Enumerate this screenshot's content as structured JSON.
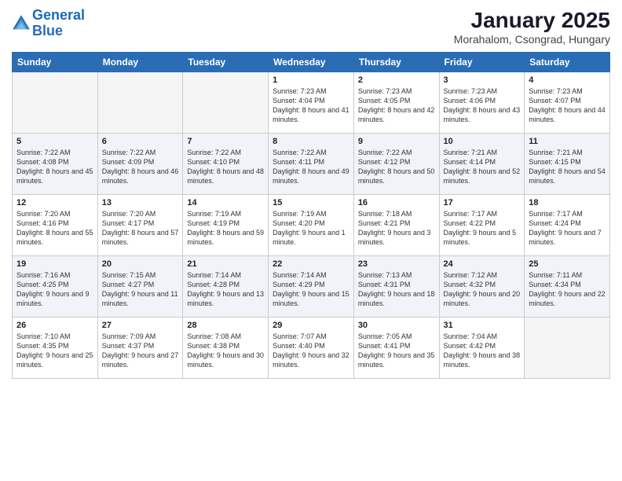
{
  "header": {
    "logo_line1": "General",
    "logo_line2": "Blue",
    "month_title": "January 2025",
    "location": "Morahalom, Csongrad, Hungary"
  },
  "days_of_week": [
    "Sunday",
    "Monday",
    "Tuesday",
    "Wednesday",
    "Thursday",
    "Friday",
    "Saturday"
  ],
  "weeks": [
    [
      {
        "day": "",
        "empty": true
      },
      {
        "day": "",
        "empty": true
      },
      {
        "day": "",
        "empty": true
      },
      {
        "day": "1",
        "sunrise": "7:23 AM",
        "sunset": "4:04 PM",
        "daylight": "8 hours and 41 minutes."
      },
      {
        "day": "2",
        "sunrise": "7:23 AM",
        "sunset": "4:05 PM",
        "daylight": "8 hours and 42 minutes."
      },
      {
        "day": "3",
        "sunrise": "7:23 AM",
        "sunset": "4:06 PM",
        "daylight": "8 hours and 43 minutes."
      },
      {
        "day": "4",
        "sunrise": "7:23 AM",
        "sunset": "4:07 PM",
        "daylight": "8 hours and 44 minutes."
      }
    ],
    [
      {
        "day": "5",
        "sunrise": "7:22 AM",
        "sunset": "4:08 PM",
        "daylight": "8 hours and 45 minutes."
      },
      {
        "day": "6",
        "sunrise": "7:22 AM",
        "sunset": "4:09 PM",
        "daylight": "8 hours and 46 minutes."
      },
      {
        "day": "7",
        "sunrise": "7:22 AM",
        "sunset": "4:10 PM",
        "daylight": "8 hours and 48 minutes."
      },
      {
        "day": "8",
        "sunrise": "7:22 AM",
        "sunset": "4:11 PM",
        "daylight": "8 hours and 49 minutes."
      },
      {
        "day": "9",
        "sunrise": "7:22 AM",
        "sunset": "4:12 PM",
        "daylight": "8 hours and 50 minutes."
      },
      {
        "day": "10",
        "sunrise": "7:21 AM",
        "sunset": "4:14 PM",
        "daylight": "8 hours and 52 minutes."
      },
      {
        "day": "11",
        "sunrise": "7:21 AM",
        "sunset": "4:15 PM",
        "daylight": "8 hours and 54 minutes."
      }
    ],
    [
      {
        "day": "12",
        "sunrise": "7:20 AM",
        "sunset": "4:16 PM",
        "daylight": "8 hours and 55 minutes."
      },
      {
        "day": "13",
        "sunrise": "7:20 AM",
        "sunset": "4:17 PM",
        "daylight": "8 hours and 57 minutes."
      },
      {
        "day": "14",
        "sunrise": "7:19 AM",
        "sunset": "4:19 PM",
        "daylight": "8 hours and 59 minutes."
      },
      {
        "day": "15",
        "sunrise": "7:19 AM",
        "sunset": "4:20 PM",
        "daylight": "9 hours and 1 minute."
      },
      {
        "day": "16",
        "sunrise": "7:18 AM",
        "sunset": "4:21 PM",
        "daylight": "9 hours and 3 minutes."
      },
      {
        "day": "17",
        "sunrise": "7:17 AM",
        "sunset": "4:22 PM",
        "daylight": "9 hours and 5 minutes."
      },
      {
        "day": "18",
        "sunrise": "7:17 AM",
        "sunset": "4:24 PM",
        "daylight": "9 hours and 7 minutes."
      }
    ],
    [
      {
        "day": "19",
        "sunrise": "7:16 AM",
        "sunset": "4:25 PM",
        "daylight": "9 hours and 9 minutes."
      },
      {
        "day": "20",
        "sunrise": "7:15 AM",
        "sunset": "4:27 PM",
        "daylight": "9 hours and 11 minutes."
      },
      {
        "day": "21",
        "sunrise": "7:14 AM",
        "sunset": "4:28 PM",
        "daylight": "9 hours and 13 minutes."
      },
      {
        "day": "22",
        "sunrise": "7:14 AM",
        "sunset": "4:29 PM",
        "daylight": "9 hours and 15 minutes."
      },
      {
        "day": "23",
        "sunrise": "7:13 AM",
        "sunset": "4:31 PM",
        "daylight": "9 hours and 18 minutes."
      },
      {
        "day": "24",
        "sunrise": "7:12 AM",
        "sunset": "4:32 PM",
        "daylight": "9 hours and 20 minutes."
      },
      {
        "day": "25",
        "sunrise": "7:11 AM",
        "sunset": "4:34 PM",
        "daylight": "9 hours and 22 minutes."
      }
    ],
    [
      {
        "day": "26",
        "sunrise": "7:10 AM",
        "sunset": "4:35 PM",
        "daylight": "9 hours and 25 minutes."
      },
      {
        "day": "27",
        "sunrise": "7:09 AM",
        "sunset": "4:37 PM",
        "daylight": "9 hours and 27 minutes."
      },
      {
        "day": "28",
        "sunrise": "7:08 AM",
        "sunset": "4:38 PM",
        "daylight": "9 hours and 30 minutes."
      },
      {
        "day": "29",
        "sunrise": "7:07 AM",
        "sunset": "4:40 PM",
        "daylight": "9 hours and 32 minutes."
      },
      {
        "day": "30",
        "sunrise": "7:05 AM",
        "sunset": "4:41 PM",
        "daylight": "9 hours and 35 minutes."
      },
      {
        "day": "31",
        "sunrise": "7:04 AM",
        "sunset": "4:42 PM",
        "daylight": "9 hours and 38 minutes."
      },
      {
        "day": "",
        "empty": true
      }
    ]
  ]
}
